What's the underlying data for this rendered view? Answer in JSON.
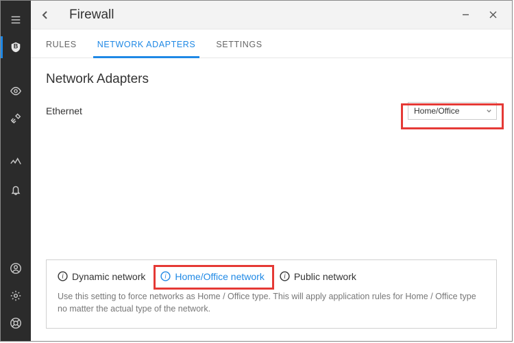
{
  "window": {
    "title": "Firewall"
  },
  "sidebar": {
    "items": [
      {
        "name": "menu"
      },
      {
        "name": "shield"
      },
      {
        "name": "privacy"
      },
      {
        "name": "tools"
      },
      {
        "name": "activity"
      },
      {
        "name": "notifications"
      },
      {
        "name": "account"
      },
      {
        "name": "settings"
      },
      {
        "name": "support"
      }
    ]
  },
  "tabs": [
    {
      "label": "RULES",
      "active": false
    },
    {
      "label": "NETWORK ADAPTERS",
      "active": true
    },
    {
      "label": "SETTINGS",
      "active": false
    }
  ],
  "section": {
    "title": "Network Adapters"
  },
  "adapters": [
    {
      "name": "Ethernet",
      "selected": "Home/Office"
    }
  ],
  "legend": {
    "items": [
      {
        "label": "Dynamic network",
        "active": false
      },
      {
        "label": "Home/Office network",
        "active": true
      },
      {
        "label": "Public network",
        "active": false
      }
    ],
    "description": "Use this setting to force networks as Home / Office type. This will apply application rules for Home / Office type no matter the actual type of the network."
  }
}
